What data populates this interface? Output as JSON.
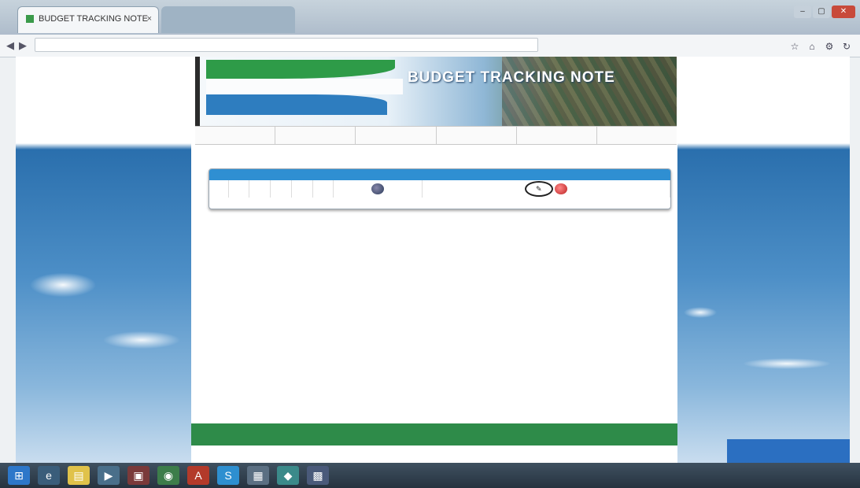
{
  "browser": {
    "tabs": [
      {
        "label": "BUDGET TRACKING NOTE",
        "active": true
      },
      {
        "label": "",
        "active": false
      }
    ],
    "close_symbol": "×",
    "window_buttons": [
      "–",
      "▢",
      "✕"
    ],
    "url": "",
    "nav_icons": [
      "back-arrow-icon",
      "forward-arrow-icon"
    ],
    "toolbar_icons": [
      "star-icon",
      "home-icon",
      "settings-icon",
      "refresh-icon"
    ]
  },
  "site": {
    "banner_title": "BUDGET TRACKING NOTE",
    "ministry_text": "",
    "menu": [
      "",
      "",
      "",
      "",
      "",
      ""
    ],
    "section_title": "",
    "table": {
      "headers": [
        "",
        "",
        "",
        "",
        "",
        "",
        "",
        ""
      ],
      "rows": [
        {
          "cells": [
            "",
            "",
            "",
            "",
            "",
            ""
          ],
          "actions": [
            "view-icon",
            "edit-icon",
            "delete-icon"
          ],
          "edit_symbol": "✎"
        }
      ]
    },
    "footer_text": "",
    "chat_label": ""
  },
  "taskbar": {
    "items": [
      "start-icon",
      "ie-icon",
      "folder-icon",
      "media-icon",
      "app-icon",
      "chrome-icon",
      "pdf-icon",
      "skype-icon",
      "files-icon",
      "app2-icon",
      "app3-icon"
    ],
    "tray_text": ""
  },
  "colors": {
    "table_header": "#2f8fd2",
    "footer": "#2e8b49",
    "flag_green": "#2e9b48",
    "flag_blue": "#2e7dbf"
  }
}
